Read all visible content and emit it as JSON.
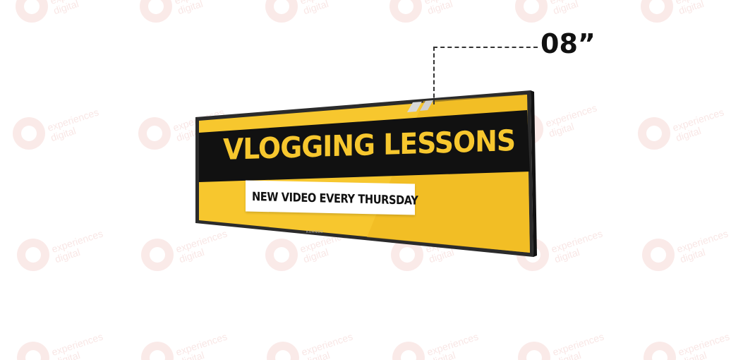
{
  "dimension": {
    "label": "08”"
  },
  "screen": {
    "headline": "VLOGGING LESSONS",
    "subline": "NEW VIDEO EVERY THURSDAY",
    "bezel_brand": "KUANBO"
  },
  "watermark": {
    "text": "experiences\ndigital",
    "icon": "3d-logo-icon"
  },
  "colors": {
    "yellow": "#f7c72e",
    "dark_band": "#111111",
    "bezel": "#2b2b2b",
    "watermark": "#f3cfcc"
  }
}
